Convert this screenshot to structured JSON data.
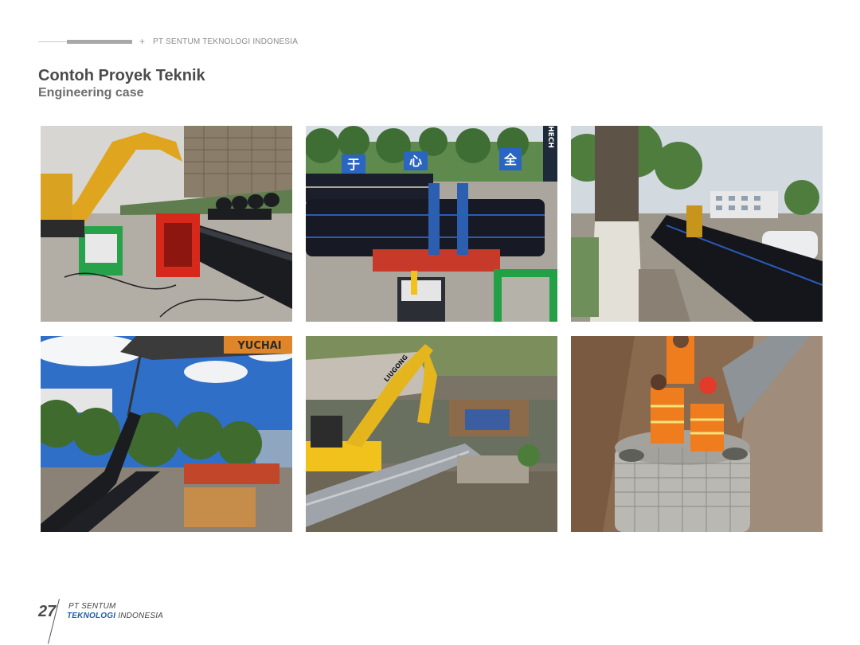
{
  "header": {
    "plus_symbol": "+",
    "company": "PT SENTUM TEKNOLOGI INDONESIA"
  },
  "title": "Contoh Proyek Teknik",
  "subtitle": "Engineering case",
  "photos": [
    {
      "name": "excavator-pipe-welding-site"
    },
    {
      "name": "pipe-fusion-machine"
    },
    {
      "name": "roadside-pipeline-laying"
    },
    {
      "name": "crane-lifting-pipe"
    },
    {
      "name": "river-crossing-pipe-install"
    },
    {
      "name": "workers-manhole-construction"
    }
  ],
  "photo_text": {
    "sign1": "于",
    "sign2": "心",
    "sign3": "全",
    "pole": "HECH",
    "crane_brand": "YUCHAI",
    "excavator_brand": "LIUGONG"
  },
  "footer": {
    "page_number": "27",
    "line1": "PT SENTUM",
    "line2_highlight": "TEKNOLOGI",
    "line2_rest": " INDONESIA"
  }
}
